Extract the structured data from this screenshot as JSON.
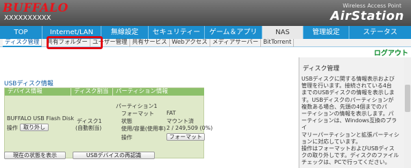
{
  "header": {
    "brand": "BUFFALO",
    "model": "XXXXXXXXXX",
    "product_small": "Wireless Access Point",
    "product": "AirStation"
  },
  "nav": {
    "items": [
      "TOP",
      "Internet/LAN",
      "無線設定",
      "セキュリティー",
      "ゲーム＆アプリ",
      "NAS",
      "管理設定",
      "ステータス"
    ],
    "active": "NAS"
  },
  "subnav": {
    "items": [
      "ディスク管理",
      "共有フォルダー",
      "ユーザー管理",
      "共有サービス",
      "Webアクセス",
      "メディアサーバー",
      "BitTorrent"
    ]
  },
  "logout": "ログアウト",
  "main": {
    "section_title": "USBディスク情報",
    "headers": [
      "デバイス情報",
      "ディスク割当",
      "パーティション情報"
    ],
    "device": {
      "name": "BUFFALO USB Flash Disk",
      "operation_label": "操作",
      "remove_button": "取り外し"
    },
    "allocation": [
      "ディスク1",
      "(自動割当)"
    ],
    "partition": {
      "name": "パーティション1",
      "format_label": "フォーマット",
      "format_value": "FAT",
      "state_label": "状態",
      "state_value": "マウント済",
      "usage_label": "使用/容量(使用率)",
      "usage_value": "2 / 249,509 (0%)",
      "operation_label": "操作",
      "format_button": "フォーマット"
    },
    "bottom_buttons": [
      "現在の状態を表示",
      "USBデバイスの再認識"
    ]
  },
  "sidebar": {
    "title": "ディスク管理",
    "lines": [
      "USBディスクに関する情報表示および",
      "管理を行います。接続されている4台",
      "までのUSBディスクの情報を表示しま",
      "す。USBディスクのパーティションが",
      "複数ある場合、先頭の4個までのパ",
      "ーティションの情報を表示します。パ",
      "ーティションは、Windows互換のプライ",
      "マリーパーティションと拡張パーティシ",
      "ョンに対応しています。",
      "操作はフォーマットおよびUSBディス",
      "クの取り外しです。ディスクのファイル",
      "チェックは、PCで行ってください。"
    ]
  }
}
